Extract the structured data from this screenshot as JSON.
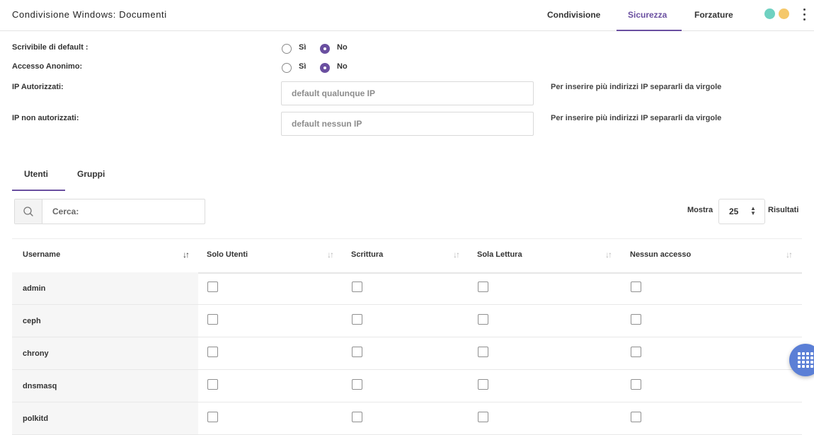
{
  "header": {
    "title": "Condivisione Windows: Documenti",
    "tabs": [
      {
        "label": "Condivisione",
        "active": false
      },
      {
        "label": "Sicurezza",
        "active": true
      },
      {
        "label": "Forzature",
        "active": false
      }
    ],
    "status_dots": [
      "#6fd1c1",
      "#f5c86a"
    ],
    "accent_color": "#6a4fa0"
  },
  "form": {
    "scrivibile": {
      "label": "Scrivibile di default :",
      "options": [
        "Sì",
        "No"
      ],
      "selected": "No"
    },
    "anonimo": {
      "label": "Accesso Anonimo:",
      "options": [
        "Sì",
        "No"
      ],
      "selected": "No"
    },
    "ip_autorizzati": {
      "label": "IP Autorizzati:",
      "value": "",
      "placeholder": "default qualunque IP",
      "hint": "Per inserire più indirizzi IP separarli da virgole"
    },
    "ip_non_autorizzati": {
      "label": "IP non autorizzati:",
      "value": "",
      "placeholder": "default nessun IP",
      "hint": "Per inserire più indirizzi IP separarli da virgole"
    }
  },
  "inner_tabs": [
    {
      "label": "Utenti",
      "active": true
    },
    {
      "label": "Gruppi",
      "active": false
    }
  ],
  "search": {
    "placeholder": "Cerca:",
    "icon": "search-icon"
  },
  "pagination": {
    "show_label": "Mostra",
    "page_size": "25",
    "results_label": "Risultati"
  },
  "table": {
    "columns": [
      "Username",
      "Solo Utenti",
      "Scrittura",
      "Sola Lettura",
      "Nessun accesso"
    ],
    "rows": [
      {
        "username": "admin",
        "checks": [
          false,
          false,
          false,
          false
        ]
      },
      {
        "username": "ceph",
        "checks": [
          false,
          false,
          false,
          false
        ]
      },
      {
        "username": "chrony",
        "checks": [
          false,
          false,
          false,
          false
        ]
      },
      {
        "username": "dnsmasq",
        "checks": [
          false,
          false,
          false,
          false
        ]
      },
      {
        "username": "polkitd",
        "checks": [
          false,
          false,
          false,
          false
        ]
      }
    ]
  },
  "fab": {
    "icon": "grid-apps-icon",
    "color": "#5b7fd6"
  }
}
